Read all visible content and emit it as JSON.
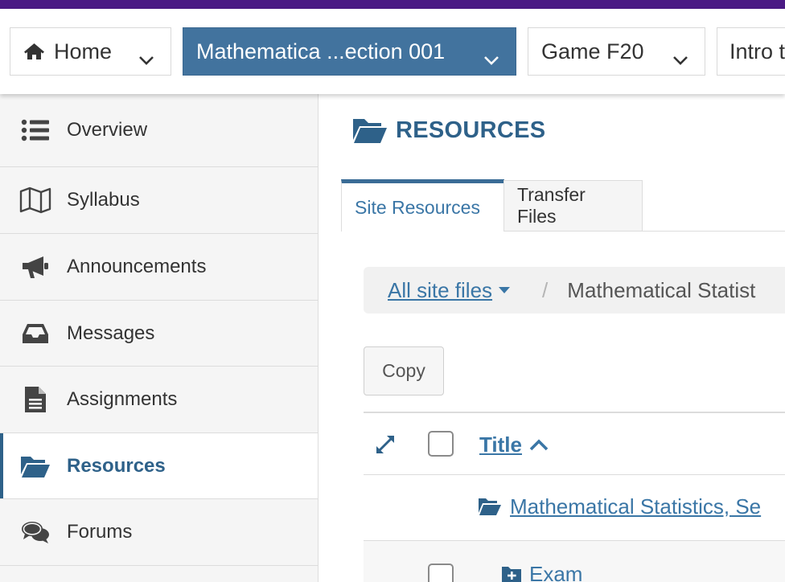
{
  "site_tabs": [
    {
      "label": "Home",
      "icon": "home-icon"
    },
    {
      "label": "Mathematica ...ection 001",
      "active": true
    },
    {
      "label": "Game F20"
    },
    {
      "label": "Intro t"
    }
  ],
  "sidebar": {
    "items": [
      {
        "label": "Overview",
        "icon": "list-icon"
      },
      {
        "label": "Syllabus",
        "icon": "map-icon"
      },
      {
        "label": "Announcements",
        "icon": "bullhorn-icon"
      },
      {
        "label": "Messages",
        "icon": "inbox-icon"
      },
      {
        "label": "Assignments",
        "icon": "file-text-icon"
      },
      {
        "label": "Resources",
        "icon": "folder-open-icon",
        "active": true
      },
      {
        "label": "Forums",
        "icon": "comments-icon"
      }
    ]
  },
  "main": {
    "title": "RESOURCES",
    "tabs": [
      {
        "label": "Site Resources",
        "selected": true
      },
      {
        "label": "Transfer Files"
      }
    ],
    "breadcrumb": {
      "root": "All site files ",
      "separator": "/",
      "current": "Mathematical Statist"
    },
    "copy_label": "Copy",
    "table": {
      "title_header": "Title",
      "rows": [
        {
          "label": "Mathematical Statistics, Se",
          "icon": "folder-open-icon"
        },
        {
          "label": "Exam",
          "icon": "folder-plus-icon"
        }
      ]
    }
  },
  "colors": {
    "top_strip": "#4b1a84",
    "active_site_tab": "#42739e",
    "brand_blue": "#2e6189",
    "link_blue": "#3a76a6"
  }
}
